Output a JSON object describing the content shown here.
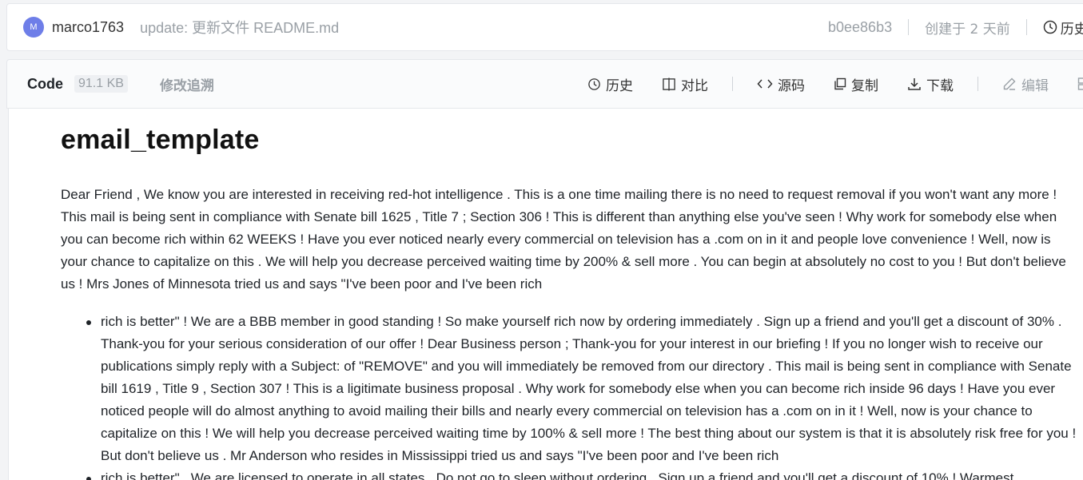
{
  "commit": {
    "avatar_letter": "M",
    "author": "marco1763",
    "message": "update: 更新文件 README.md",
    "hash": "b0ee86b3",
    "created": "创建于 2 天前",
    "history": "历史"
  },
  "file_header": {
    "code_tab": "Code",
    "size": "91.1 KB",
    "blame_tab": "修改追溯",
    "tools": {
      "history": "历史",
      "compare": "对比",
      "source": "源码",
      "copy": "复制",
      "download": "下载",
      "edit": "编辑"
    }
  },
  "document": {
    "title": "email_template",
    "paragraph": "Dear Friend , We know you are interested in receiving red-hot intelligence . This is a one time mailing there is no need to request removal if you won't want any more ! This mail is being sent in compliance with Senate bill 1625 , Title 7 ; Section 306 ! This is different than anything else you've seen ! Why work for somebody else when you can become rich within 62 WEEKS ! Have you ever noticed nearly every commercial on television has a .com on in it and people love convenience ! Well, now is your chance to capitalize on this . We will help you decrease perceived waiting time by 200% & sell more . You can begin at absolutely no cost to you ! But don't believe us ! Mrs Jones of Minnesota tried us and says \"I've been poor and I've been rich",
    "bullets": [
      "rich is better\" ! We are a BBB member in good standing ! So make yourself rich now by ordering immediately . Sign up a friend and you'll get a discount of 30% . Thank-you for your serious consideration of our offer ! Dear Business person ; Thank-you for your interest in our briefing ! If you no longer wish to receive our publications simply reply with a Subject: of \"REMOVE\" and you will immediately be removed from our directory . This mail is being sent in compliance with Senate bill 1619 , Title 9 , Section 307 ! This is a ligitimate business proposal . Why work for somebody else when you can become rich inside 96 days ! Have you ever noticed people will do almost anything to avoid mailing their bills and nearly every commercial on television has a .com on in it ! Well, now is your chance to capitalize on this ! We will help you decrease perceived waiting time by 100% & sell more ! The best thing about our system is that it is absolutely risk free for you ! But don't believe us . Mr Anderson who resides in Mississippi tried us and says \"I've been poor and I've been rich",
      "rich is better\" . We are licensed to operate in all states . Do not go to sleep without ordering . Sign up a friend and you'll get a discount of 10% ! Warmest"
    ]
  }
}
